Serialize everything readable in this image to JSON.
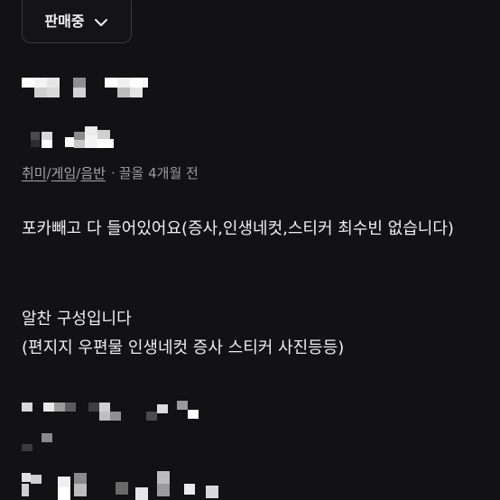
{
  "status": {
    "label": "판매중",
    "icon": "chevron-down-icon"
  },
  "category": {
    "items": [
      "취미",
      "게임",
      "음반"
    ],
    "separator": "/",
    "dot": "·",
    "time": "끌올 4개월 전"
  },
  "description": {
    "paragraph_1": "포카빼고 다 들어있어요(증사,인생네컷,스티커 최수빈 없습니다)",
    "paragraph_2": "알찬 구성입니다\n(편지지 우편물 인생네컷 증사 스티커 사진등등)"
  },
  "colors": {
    "background": "#121214",
    "text": "#eeeef2",
    "muted": "#9a9aa2",
    "chip_border": "#3a3a40"
  }
}
